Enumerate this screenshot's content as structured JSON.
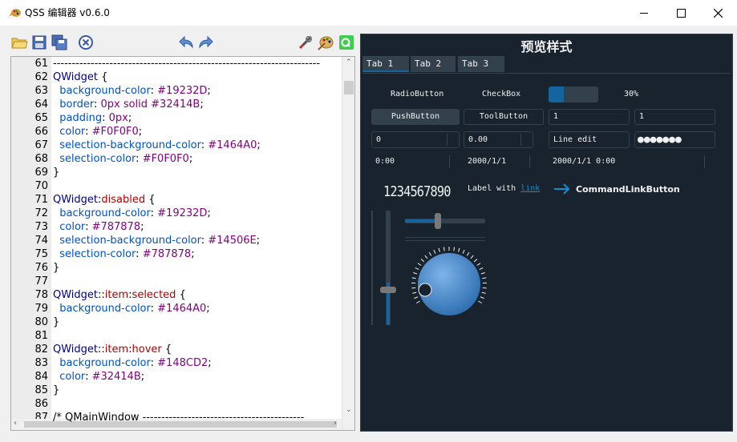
{
  "window": {
    "title": "QSS 编辑器 v0.6.0",
    "minimize": "—",
    "maximize": "☐",
    "close": "✕"
  },
  "toolbar": {
    "icons": [
      "open-folder-icon",
      "save-icon",
      "save-as-icon",
      "close-file-icon",
      "undo-icon",
      "redo-icon",
      "tools-icon",
      "palette-icon",
      "qt-icon"
    ]
  },
  "editor": {
    "lines": [
      {
        "n": "61",
        "parts": [
          [
            "cmt",
            "-----------------------------------------------------------------------"
          ]
        ]
      },
      {
        "n": "62",
        "parts": [
          [
            "sel",
            "QWidget"
          ],
          [
            "pun",
            " {"
          ]
        ]
      },
      {
        "n": "63",
        "parts": [
          [
            "prop",
            "  background-color"
          ],
          [
            "pun",
            ": "
          ],
          [
            "val",
            "#19232D"
          ],
          [
            "pun",
            ";"
          ]
        ]
      },
      {
        "n": "64",
        "parts": [
          [
            "prop",
            "  border"
          ],
          [
            "pun",
            ": "
          ],
          [
            "val",
            "0px solid #32414B"
          ],
          [
            "pun",
            ";"
          ]
        ]
      },
      {
        "n": "65",
        "parts": [
          [
            "prop",
            "  padding"
          ],
          [
            "pun",
            ": "
          ],
          [
            "val",
            "0px"
          ],
          [
            "pun",
            ";"
          ]
        ]
      },
      {
        "n": "66",
        "parts": [
          [
            "prop",
            "  color"
          ],
          [
            "pun",
            ": "
          ],
          [
            "val",
            "#F0F0F0"
          ],
          [
            "pun",
            ";"
          ]
        ]
      },
      {
        "n": "67",
        "parts": [
          [
            "prop",
            "  selection-background-color"
          ],
          [
            "pun",
            ": "
          ],
          [
            "val",
            "#1464A0"
          ],
          [
            "pun",
            ";"
          ]
        ]
      },
      {
        "n": "68",
        "parts": [
          [
            "prop",
            "  selection-color"
          ],
          [
            "pun",
            ": "
          ],
          [
            "val",
            "#F0F0F0"
          ],
          [
            "pun",
            ";"
          ]
        ]
      },
      {
        "n": "69",
        "parts": [
          [
            "pun",
            "}"
          ]
        ]
      },
      {
        "n": "70",
        "parts": []
      },
      {
        "n": "71",
        "parts": [
          [
            "sel",
            "QWidget"
          ],
          [
            "pun",
            ":"
          ],
          [
            "pseudo",
            "disabled"
          ],
          [
            "pun",
            " {"
          ]
        ]
      },
      {
        "n": "72",
        "parts": [
          [
            "prop",
            "  background-color"
          ],
          [
            "pun",
            ": "
          ],
          [
            "val",
            "#19232D"
          ],
          [
            "pun",
            ";"
          ]
        ]
      },
      {
        "n": "73",
        "parts": [
          [
            "prop",
            "  color"
          ],
          [
            "pun",
            ": "
          ],
          [
            "val",
            "#787878"
          ],
          [
            "pun",
            ";"
          ]
        ]
      },
      {
        "n": "74",
        "parts": [
          [
            "prop",
            "  selection-background-color"
          ],
          [
            "pun",
            ": "
          ],
          [
            "val",
            "#14506E"
          ],
          [
            "pun",
            ";"
          ]
        ]
      },
      {
        "n": "75",
        "parts": [
          [
            "prop",
            "  selection-color"
          ],
          [
            "pun",
            ": "
          ],
          [
            "val",
            "#787878"
          ],
          [
            "pun",
            ";"
          ]
        ]
      },
      {
        "n": "76",
        "parts": [
          [
            "pun",
            "}"
          ]
        ]
      },
      {
        "n": "77",
        "parts": []
      },
      {
        "n": "78",
        "parts": [
          [
            "sel",
            "QWidget"
          ],
          [
            "pun",
            "::"
          ],
          [
            "pseudo",
            "item"
          ],
          [
            "pun",
            ":"
          ],
          [
            "pseudo",
            "selected"
          ],
          [
            "pun",
            " {"
          ]
        ]
      },
      {
        "n": "79",
        "parts": [
          [
            "prop",
            "  background-color"
          ],
          [
            "pun",
            ": "
          ],
          [
            "val",
            "#1464A0"
          ],
          [
            "pun",
            ";"
          ]
        ]
      },
      {
        "n": "80",
        "parts": [
          [
            "pun",
            "}"
          ]
        ]
      },
      {
        "n": "81",
        "parts": []
      },
      {
        "n": "82",
        "parts": [
          [
            "sel",
            "QWidget"
          ],
          [
            "pun",
            "::"
          ],
          [
            "pseudo",
            "item"
          ],
          [
            "pun",
            ":"
          ],
          [
            "pseudo",
            "hover"
          ],
          [
            "pun",
            " {"
          ]
        ]
      },
      {
        "n": "83",
        "parts": [
          [
            "prop",
            "  background-color"
          ],
          [
            "pun",
            ": "
          ],
          [
            "val",
            "#148CD2"
          ],
          [
            "pun",
            ";"
          ]
        ]
      },
      {
        "n": "84",
        "parts": [
          [
            "prop",
            "  color"
          ],
          [
            "pun",
            ": "
          ],
          [
            "val",
            "#32414B"
          ],
          [
            "pun",
            ";"
          ]
        ]
      },
      {
        "n": "85",
        "parts": [
          [
            "pun",
            "}"
          ]
        ]
      },
      {
        "n": "86",
        "parts": []
      },
      {
        "n": "87",
        "parts": [
          [
            "cmt",
            "/* QMainWindow -------------------------------------------"
          ]
        ]
      }
    ]
  },
  "preview": {
    "title": "预览样式",
    "tabs": [
      "Tab 1",
      "Tab 2",
      "Tab 3"
    ],
    "radio_label": "RadioButton",
    "checkbox_label": "CheckBox",
    "progress_value": 30,
    "progress_text": "30%",
    "push_button": "PushButton",
    "tool_button": "ToolButton",
    "combo1_value": "1",
    "combo2_value": "1",
    "spin_int": "0",
    "spin_double": "0.00",
    "line_edit": "Line edit",
    "password_mask": "●●●●●●●",
    "time_edit": "0:00",
    "date_edit": "2000/1/1",
    "datetime_edit": "2000/1/1 0:00",
    "lcd_number": "1234567890",
    "label_prefix": "Label with ",
    "label_link": "link",
    "command_link": "CommandLinkButton",
    "hslider_value": 0.4,
    "vslider_value": 0.7,
    "colors": {
      "bg": "#19232D",
      "border": "#32414B",
      "accent": "#1464A0",
      "text": "#F0F0F0",
      "link": "#148CD2"
    }
  }
}
